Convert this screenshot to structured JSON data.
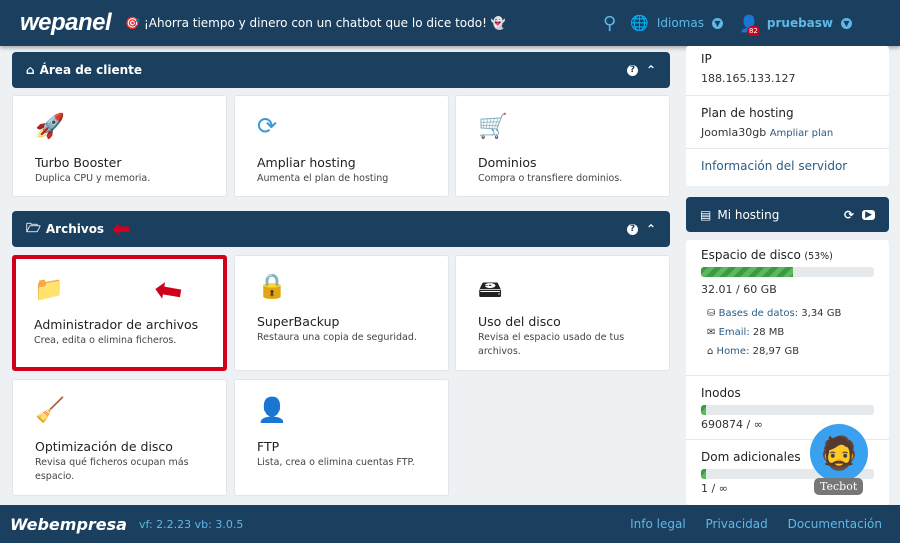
{
  "header": {
    "logo": "wepanel",
    "promo": "🎯 ¡Ahorra tiempo y dinero con un chatbot que lo dice todo! 👻",
    "languages": "Idiomas",
    "user": "pruebasw",
    "badge": "82"
  },
  "client_area": {
    "title": "Área de cliente",
    "cards": [
      {
        "title": "Turbo Booster",
        "desc": "Duplica CPU y memoria.",
        "icon": "rocket-icon"
      },
      {
        "title": "Ampliar hosting",
        "desc": "Aumenta el plan de hosting",
        "icon": "upgrade-icon"
      },
      {
        "title": "Dominios",
        "desc": "Compra o transfiere dominios.",
        "icon": "cart-icon"
      }
    ]
  },
  "files": {
    "title": "Archivos",
    "cards": [
      {
        "title": "Administrador de archivos",
        "desc": "Crea, edita o elimina ficheros.",
        "icon": "folder-icon"
      },
      {
        "title": "SuperBackup",
        "desc": "Restaura una copia de seguridad.",
        "icon": "safe-icon"
      },
      {
        "title": "Uso del disco",
        "desc": "Revisa el espacio usado de tus archivos.",
        "icon": "disk-icon"
      },
      {
        "title": "Optimización de disco",
        "desc": "Revisa qué ficheros ocupan más espacio.",
        "icon": "vacuum-icon"
      },
      {
        "title": "FTP",
        "desc": "Lista, crea o elimina cuentas FTP.",
        "icon": "ftp-user-icon"
      }
    ]
  },
  "server": {
    "ip_label": "IP",
    "ip": "188.165.133.127",
    "plan_label": "Plan de hosting",
    "plan": "Joomla30gb",
    "upgrade": "Ampliar plan",
    "info": "Información del servidor"
  },
  "hosting": {
    "title": "Mi hosting",
    "disk_label": "Espacio de disco",
    "disk_pct_text": "(53%)",
    "disk_pct": 53,
    "disk_used": "32.01 / 60 GB",
    "db": "Bases de datos:",
    "db_val": "3,34 GB",
    "email": "Email:",
    "email_val": "28 MB",
    "home": "Home:",
    "home_val": "28,97 GB",
    "inodes_label": "Inodos",
    "inodes": "690874 / ∞",
    "inodes_pct": 3,
    "dom_label": "Dom adicionales",
    "dom": "1 / ∞",
    "dom_pct": 3
  },
  "chatbot": {
    "name": "Tecbot"
  },
  "footer": {
    "logo": "Webempresa",
    "version": "vf: 2.2.23 vb: 3.0.5",
    "links": [
      "Info legal",
      "Privacidad",
      "Documentación"
    ]
  },
  "colors": {
    "primary": "#1b3f5f",
    "accent": "#5fb8e6",
    "highlight": "#d0021b",
    "progress": "#5cb85c"
  }
}
